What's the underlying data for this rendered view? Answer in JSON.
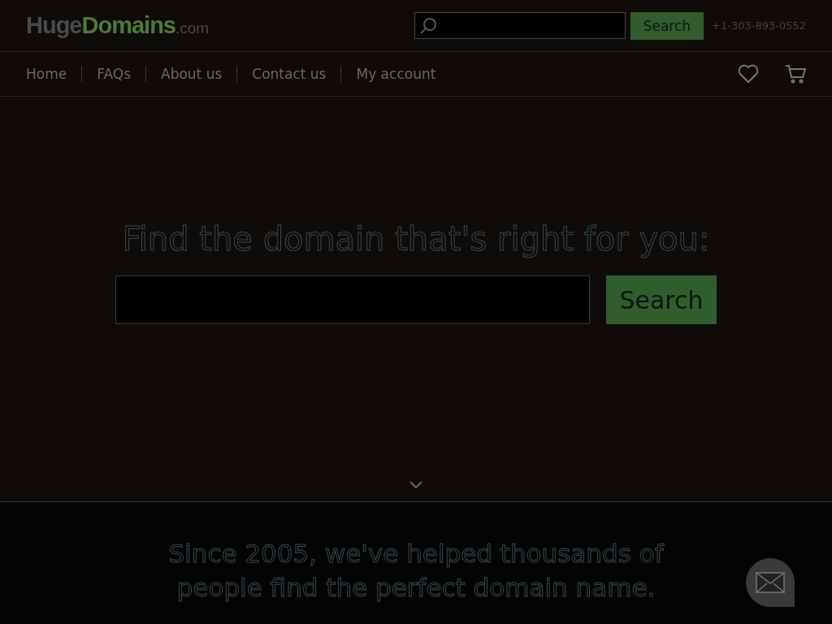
{
  "logo": {
    "part_1": "Huge",
    "part_2": "Domains",
    "part_3": ".com"
  },
  "header_search": {
    "button": "Search"
  },
  "phone": "+1-303-893-0552",
  "nav": [
    {
      "label": "Home"
    },
    {
      "label": "FAQs"
    },
    {
      "label": "About us"
    },
    {
      "label": "Contact us"
    },
    {
      "label": "My account"
    }
  ],
  "hero": {
    "title": "Find the domain that's right for you:",
    "button": "Search"
  },
  "tagline": "Since 2005, we've helped thousands of people find the perfect domain name."
}
